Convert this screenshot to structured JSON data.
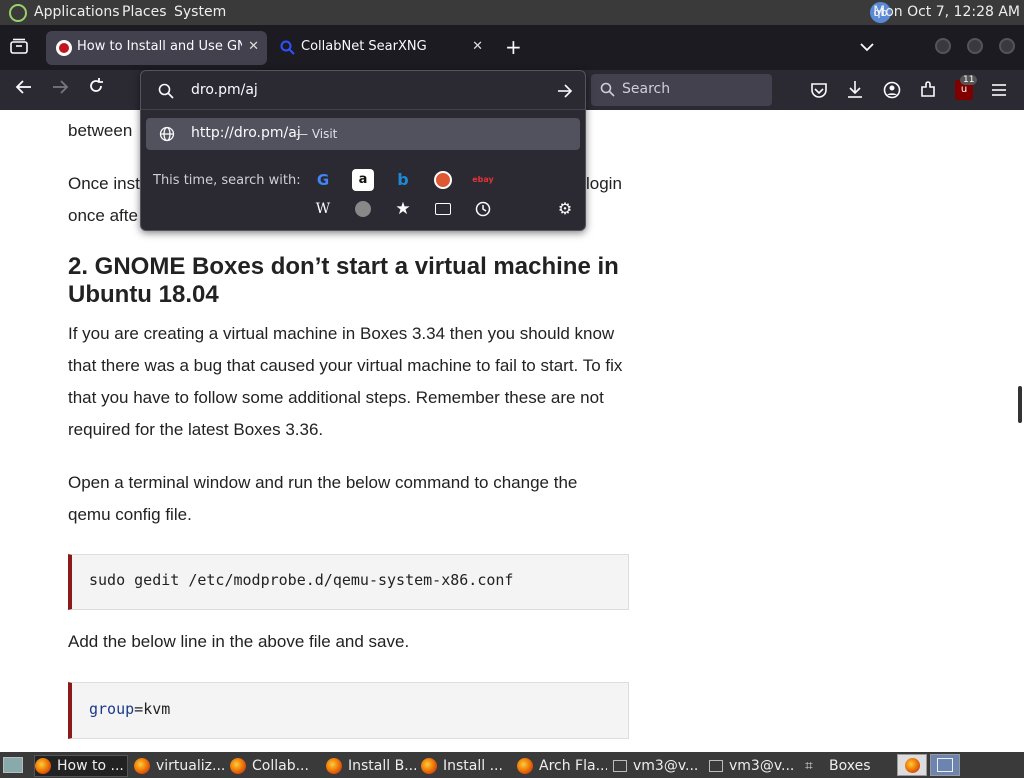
{
  "top_panel": {
    "menus": [
      "Applications",
      "Places",
      "System"
    ],
    "qb_label": "qb",
    "clock": "Mon Oct  7, 12:28 AM"
  },
  "tabs": [
    {
      "title": "How to Install and Use GNOME",
      "active": true
    },
    {
      "title": "CollabNet SearXNG",
      "active": false
    }
  ],
  "navbar": {
    "search_placeholder": "Search",
    "ublock_badge": "11"
  },
  "urlbar": {
    "value": "dro.pm/aj",
    "suggestion_url": "http://dro.pm/aj",
    "suggestion_action": "— Visit",
    "search_with_label": "This time, search with:",
    "engines": [
      "google",
      "amazon",
      "bing",
      "duckduckgo",
      "ebay",
      "wikipedia",
      "search",
      "bookmarks",
      "tabs",
      "history",
      "settings"
    ]
  },
  "content": {
    "partial_1": "between",
    "partial_2a": "Once inst",
    "partial_2b": "login",
    "partial_3": "once afte",
    "heading": "2. GNOME Boxes don’t start a virtual machine in Ubuntu 18.04",
    "para1": "If you are creating a virtual machine in Boxes 3.34 then you should know that there was a bug that caused your virtual machine to fail to start. To fix that you have to follow some additional steps. Remember these are not required for the latest Boxes 3.36.",
    "para2": "Open a terminal window and run the below command to change the qemu config file.",
    "code1": "sudo gedit /etc/modprobe.d/qemu-system-x86.conf",
    "para3": "Add the below line in the above file and save.",
    "code2_key": "group",
    "code2_eq": "=",
    "code2_val": "kvm"
  },
  "taskbar": {
    "tasks": [
      {
        "label": "How to ...",
        "icon": "firefox",
        "active": true
      },
      {
        "label": "virtualiz...",
        "icon": "firefox"
      },
      {
        "label": "Collab...",
        "icon": "firefox"
      },
      {
        "label": "Install B...",
        "icon": "firefox"
      },
      {
        "label": "Install ...",
        "icon": "firefox"
      },
      {
        "label": "Arch Fla...",
        "icon": "firefox"
      },
      {
        "label": "vm3@v...",
        "icon": "terminal"
      },
      {
        "label": "vm3@v...",
        "icon": "terminal"
      },
      {
        "label": "Boxes",
        "icon": "boxes"
      }
    ]
  },
  "colors": {
    "accent_code_border": "#8b1a1a",
    "browser_chrome": "#2b2a33"
  }
}
